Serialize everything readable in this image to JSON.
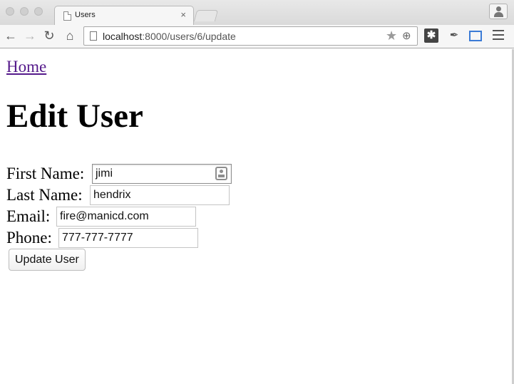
{
  "browser": {
    "tab_title": "Users",
    "tab_close": "×",
    "url_host": "localhost",
    "url_path": ":8000/users/6/update"
  },
  "page": {
    "home_link": "Home",
    "title": "Edit User",
    "form": {
      "first_name_label": "First Name:",
      "first_name_value": "jimi",
      "last_name_label": "Last Name:",
      "last_name_value": "hendrix",
      "email_label": "Email:",
      "email_value": "fire@manicd.com",
      "phone_label": "Phone:",
      "phone_value": "777-777-7777",
      "submit_label": "Update User"
    }
  },
  "colors": {
    "visited_link": "#551a8b",
    "chrome_bg": "#dadada"
  },
  "icons": [
    "back-icon",
    "forward-icon",
    "reload-icon",
    "home-icon",
    "star-icon",
    "zoom-icon",
    "extension-icon",
    "eyedropper-icon",
    "screen-capture-icon",
    "menu-icon",
    "profile-icon",
    "contact-card-icon"
  ]
}
